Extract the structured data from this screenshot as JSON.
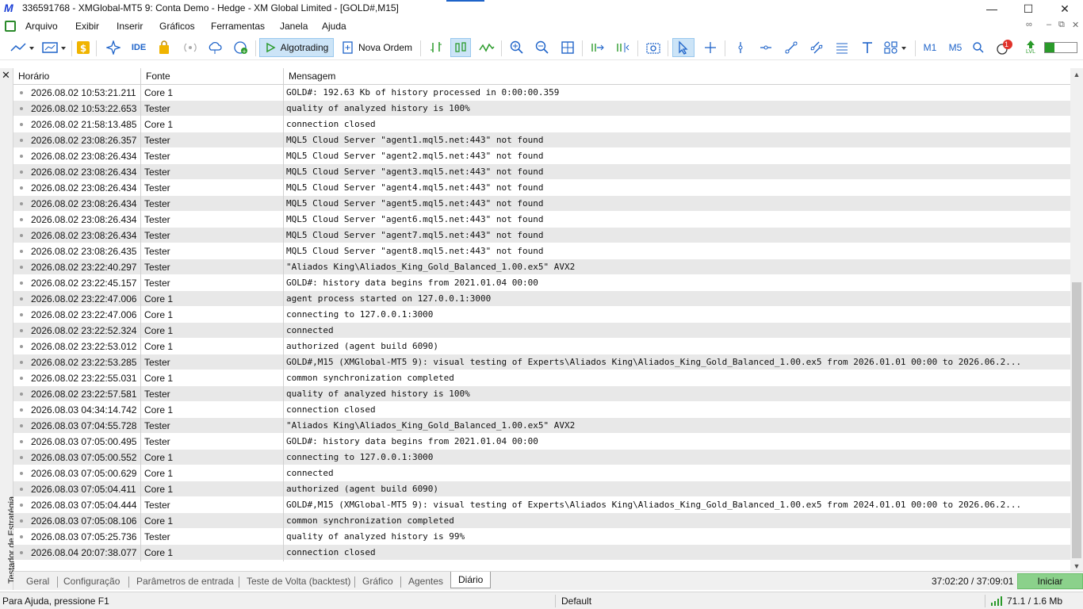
{
  "window": {
    "title": "336591768 - XMGlobal-MT5 9: Conta Demo - Hedge - XM Global Limited - [GOLD#,M15]",
    "minimize_icon": "minimize-icon",
    "maximize_icon": "maximize-icon",
    "close_icon": "close-icon"
  },
  "menu": {
    "items": [
      "Arquivo",
      "Exibir",
      "Inserir",
      "Gráficos",
      "Ferramentas",
      "Janela",
      "Ajuda"
    ]
  },
  "toolbar": {
    "ide_label": "IDE",
    "algotrading_label": "Algotrading",
    "new_order_label": "Nova Ordem",
    "m1_label": "M1",
    "m5_label": "M5",
    "notification_count": "1",
    "lvl_label": "LVL"
  },
  "panel": {
    "vertical_label": "Testador de Estratégia"
  },
  "table": {
    "columns": [
      "Horário",
      "Fonte",
      "Mensagem"
    ],
    "rows": [
      {
        "time": "2026.08.02 10:53:21.211",
        "source": "Core 1",
        "message": "GOLD#: 192.63 Kb of history processed in 0:00:00.359"
      },
      {
        "time": "2026.08.02 10:53:22.653",
        "source": "Tester",
        "message": "quality of analyzed history is 100%"
      },
      {
        "time": "2026.08.02 21:58:13.485",
        "source": "Core 1",
        "message": "connection closed"
      },
      {
        "time": "2026.08.02 23:08:26.357",
        "source": "Tester",
        "message": "MQL5 Cloud Server \"agent1.mql5.net:443\" not found"
      },
      {
        "time": "2026.08.02 23:08:26.434",
        "source": "Tester",
        "message": "MQL5 Cloud Server \"agent2.mql5.net:443\" not found"
      },
      {
        "time": "2026.08.02 23:08:26.434",
        "source": "Tester",
        "message": "MQL5 Cloud Server \"agent3.mql5.net:443\" not found"
      },
      {
        "time": "2026.08.02 23:08:26.434",
        "source": "Tester",
        "message": "MQL5 Cloud Server \"agent4.mql5.net:443\" not found"
      },
      {
        "time": "2026.08.02 23:08:26.434",
        "source": "Tester",
        "message": "MQL5 Cloud Server \"agent5.mql5.net:443\" not found"
      },
      {
        "time": "2026.08.02 23:08:26.434",
        "source": "Tester",
        "message": "MQL5 Cloud Server \"agent6.mql5.net:443\" not found"
      },
      {
        "time": "2026.08.02 23:08:26.434",
        "source": "Tester",
        "message": "MQL5 Cloud Server \"agent7.mql5.net:443\" not found"
      },
      {
        "time": "2026.08.02 23:08:26.435",
        "source": "Tester",
        "message": "MQL5 Cloud Server \"agent8.mql5.net:443\" not found"
      },
      {
        "time": "2026.08.02 23:22:40.297",
        "source": "Tester",
        "message": "\"Aliados King\\Aliados_King_Gold_Balanced_1.00.ex5\" AVX2"
      },
      {
        "time": "2026.08.02 23:22:45.157",
        "source": "Tester",
        "message": "GOLD#: history data begins from 2021.01.04 00:00"
      },
      {
        "time": "2026.08.02 23:22:47.006",
        "source": "Core 1",
        "message": "agent process started on 127.0.0.1:3000"
      },
      {
        "time": "2026.08.02 23:22:47.006",
        "source": "Core 1",
        "message": "connecting to 127.0.0.1:3000"
      },
      {
        "time": "2026.08.02 23:22:52.324",
        "source": "Core 1",
        "message": "connected"
      },
      {
        "time": "2026.08.02 23:22:53.012",
        "source": "Core 1",
        "message": "authorized (agent build 6090)"
      },
      {
        "time": "2026.08.02 23:22:53.285",
        "source": "Tester",
        "message": "GOLD#,M15 (XMGlobal-MT5 9): visual testing of Experts\\Aliados King\\Aliados_King_Gold_Balanced_1.00.ex5 from 2026.01.01 00:00 to 2026.06.2..."
      },
      {
        "time": "2026.08.02 23:22:55.031",
        "source": "Core 1",
        "message": "common synchronization completed"
      },
      {
        "time": "2026.08.02 23:22:57.581",
        "source": "Tester",
        "message": "quality of analyzed history is 100%"
      },
      {
        "time": "2026.08.03 04:34:14.742",
        "source": "Core 1",
        "message": "connection closed"
      },
      {
        "time": "2026.08.03 07:04:55.728",
        "source": "Tester",
        "message": "\"Aliados King\\Aliados_King_Gold_Balanced_1.00.ex5\" AVX2"
      },
      {
        "time": "2026.08.03 07:05:00.495",
        "source": "Tester",
        "message": "GOLD#: history data begins from 2021.01.04 00:00"
      },
      {
        "time": "2026.08.03 07:05:00.552",
        "source": "Core 1",
        "message": "connecting to 127.0.0.1:3000"
      },
      {
        "time": "2026.08.03 07:05:00.629",
        "source": "Core 1",
        "message": "connected"
      },
      {
        "time": "2026.08.03 07:05:04.411",
        "source": "Core 1",
        "message": "authorized (agent build 6090)"
      },
      {
        "time": "2026.08.03 07:05:04.444",
        "source": "Tester",
        "message": "GOLD#,M15 (XMGlobal-MT5 9): visual testing of Experts\\Aliados King\\Aliados_King_Gold_Balanced_1.00.ex5 from 2024.01.01 00:00 to 2026.06.2..."
      },
      {
        "time": "2026.08.03 07:05:08.106",
        "source": "Core 1",
        "message": "common synchronization completed"
      },
      {
        "time": "2026.08.03 07:05:25.736",
        "source": "Tester",
        "message": "quality of analyzed history is 99%"
      },
      {
        "time": "2026.08.04 20:07:38.077",
        "source": "Core 1",
        "message": "connection closed"
      }
    ]
  },
  "tabs": {
    "items": [
      "Geral",
      "Configuração",
      "Parâmetros de entrada",
      "Teste de Volta (backtest)",
      "Gráfico",
      "Agentes",
      "Diário"
    ],
    "active": "Diário",
    "time_counter": "37:02:20 / 37:09:01",
    "start_label": "Iniciar"
  },
  "status": {
    "help_text": "Para Ajuda, pressione F1",
    "profile": "Default",
    "network": "71.1 / 1.6 Mb"
  },
  "colors": {
    "start_button": "#8bd18b",
    "active_tool": "#cce4f7",
    "odd_row": "#e8e8e8"
  }
}
